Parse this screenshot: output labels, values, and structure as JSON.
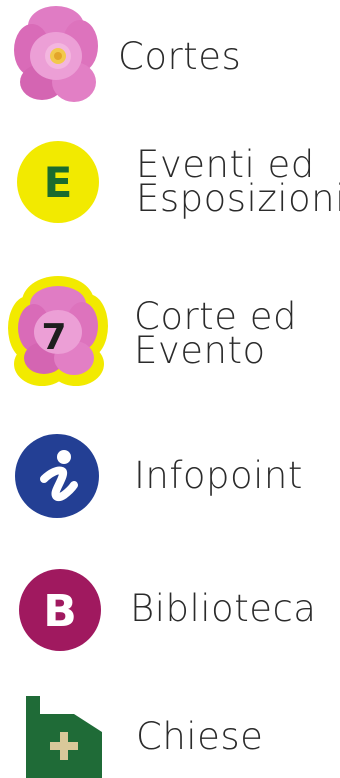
{
  "legend": {
    "items": [
      {
        "id": "cortes",
        "label": "Cortes",
        "icon": "pink-flower-icon",
        "colors": {
          "petal": "#d96bb8",
          "petal_light": "#ec9fd6",
          "center": "#f2c94c"
        }
      },
      {
        "id": "eventi",
        "label": "Eventi ed\nEsposizioni",
        "icon": "event-badge-icon",
        "badge_letter": "E",
        "colors": {
          "circle": "#f2ea00",
          "letter": "#1a6b2e"
        }
      },
      {
        "id": "corte-evento",
        "label": "Corte ed\nEvento",
        "icon": "flower-event-number-icon",
        "badge_number": "7",
        "colors": {
          "halo": "#f2ea00",
          "petal": "#d96bb8",
          "number": "#1e1e1e"
        }
      },
      {
        "id": "infopoint",
        "label": "Infopoint",
        "icon": "info-icon",
        "colors": {
          "circle": "#233f94",
          "glyph": "#ffffff"
        }
      },
      {
        "id": "biblioteca",
        "label": "Biblioteca",
        "icon": "library-badge-icon",
        "badge_letter": "B",
        "colors": {
          "circle": "#a0195f",
          "letter": "#ffffff"
        }
      },
      {
        "id": "chiese",
        "label": "Chiese",
        "icon": "church-icon",
        "colors": {
          "building": "#1f6b37",
          "cross": "#d9c89a"
        }
      }
    ]
  }
}
